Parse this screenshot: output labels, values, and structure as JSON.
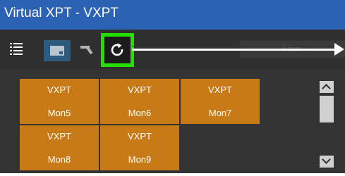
{
  "window": {
    "title": "Virtual XPT - VXPT"
  },
  "toolbar": {
    "list_icon": "list-icon",
    "screen_icon": "monitor-icon",
    "arrow_icon": "arrow-icon",
    "refresh_icon": "refresh-icon",
    "search_placeholder": "Filter"
  },
  "tiles": [
    {
      "line1": "VXPT",
      "line2": "Mon5"
    },
    {
      "line1": "VXPT",
      "line2": "Mon6"
    },
    {
      "line1": "VXPT",
      "line2": "Mon7"
    },
    {
      "line1": "VXPT",
      "line2": "Mon8"
    },
    {
      "line1": "VXPT",
      "line2": "Mon9"
    }
  ],
  "colors": {
    "title_bar": "#2c62b3",
    "tile": "#c87a17",
    "highlight": "#24e000"
  }
}
